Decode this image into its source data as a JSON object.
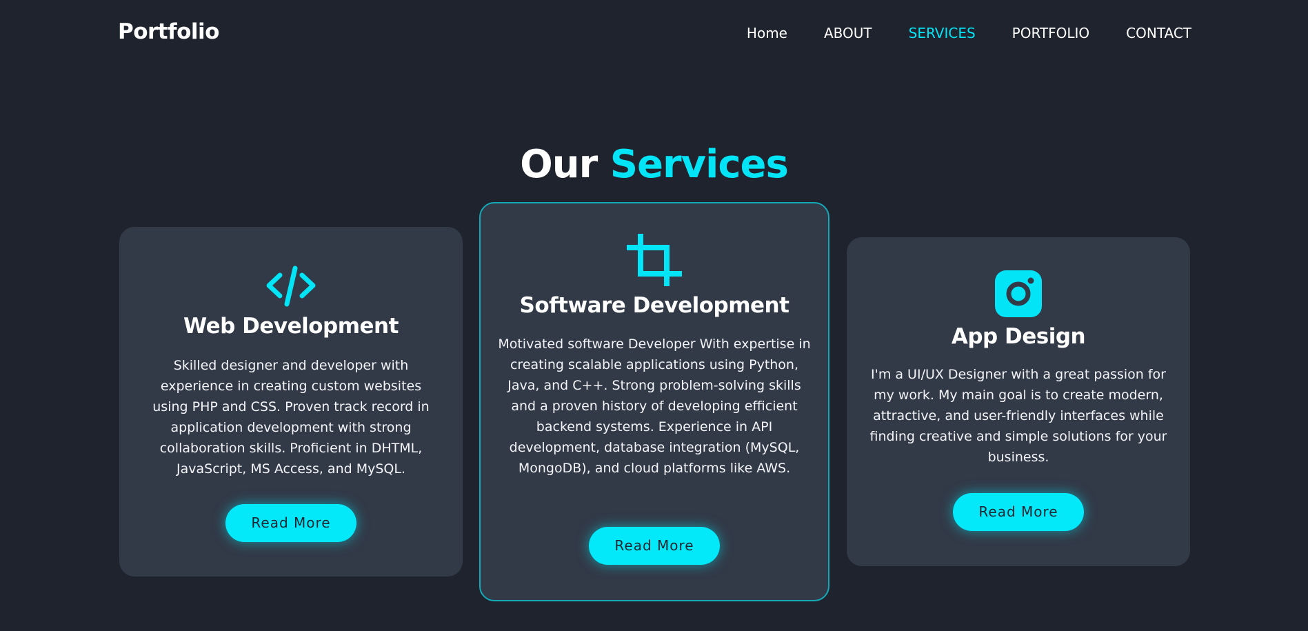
{
  "header": {
    "logo": "Portfolio",
    "nav": [
      {
        "label": "Home",
        "active": false
      },
      {
        "label": "ABOUT",
        "active": false
      },
      {
        "label": "SERVICES",
        "active": true
      },
      {
        "label": "PORTFOLIO",
        "active": false
      },
      {
        "label": "CONTACT",
        "active": false
      }
    ]
  },
  "section": {
    "title_plain": "Our",
    "title_accent": "Services"
  },
  "cards": [
    {
      "icon": "code-icon",
      "title": "Web Development",
      "description": "Skilled designer and developer with experience in creating custom websites using PHP and CSS. Proven track record in application development with strong collaboration skills. Proficient in DHTML, JavaScript, MS Access, and MySQL.",
      "button_label": "Read More"
    },
    {
      "icon": "crop-icon",
      "title": "Software Development",
      "description": "Motivated software Developer With expertise in creating scalable applications using Python, Java, and C++. Strong problem-solving skills and a proven history of developing efficient backend systems. Experience in API development, database integration (MySQL, MongoDB), and cloud platforms like AWS.",
      "button_label": "Read More"
    },
    {
      "icon": "instagram-icon",
      "title": "App Design",
      "description": "I'm a UI/UX Designer with a great passion for my work. My main goal is to create modern, attractive, and user-friendly interfaces while finding creative and simple solutions for your business.",
      "button_label": "Read More"
    }
  ],
  "colors": {
    "background": "#1f232d",
    "card": "#323947",
    "accent": "#04e4f7",
    "text": "#ffffff"
  }
}
